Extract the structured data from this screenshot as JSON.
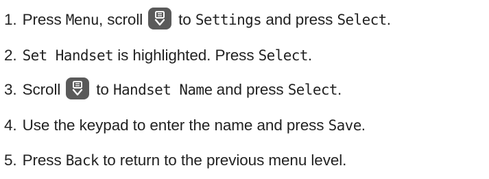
{
  "steps": [
    {
      "number": "1.",
      "parts": {
        "a": "Press ",
        "b": "Menu",
        "c": ", scroll",
        "d": "to ",
        "e": "Settings",
        "f": " and press ",
        "g": "Select",
        "h": "."
      },
      "icon": "up-down-scroll-key-icon"
    },
    {
      "number": "2.",
      "parts": {
        "a": "Set Handset",
        "b": " is highlighted. Press ",
        "c": "Select",
        "d": "."
      }
    },
    {
      "number": "3.",
      "parts": {
        "a": "Scroll",
        "b": "to ",
        "c": "Handset Name",
        "d": " and press ",
        "e": "Select",
        "f": "."
      },
      "icon": "up-down-scroll-key-icon"
    },
    {
      "number": "4.",
      "parts": {
        "a": "Use the keypad to enter the name and press ",
        "b": "Save",
        "c": "."
      }
    },
    {
      "number": "5.",
      "parts": {
        "a": "Press ",
        "b": "Back",
        "c": " to return to the previous menu level."
      }
    }
  ],
  "colors": {
    "text": "#222222",
    "nav_key_fill": "#5a5a5a",
    "nav_key_glyph": "#ffffff"
  }
}
